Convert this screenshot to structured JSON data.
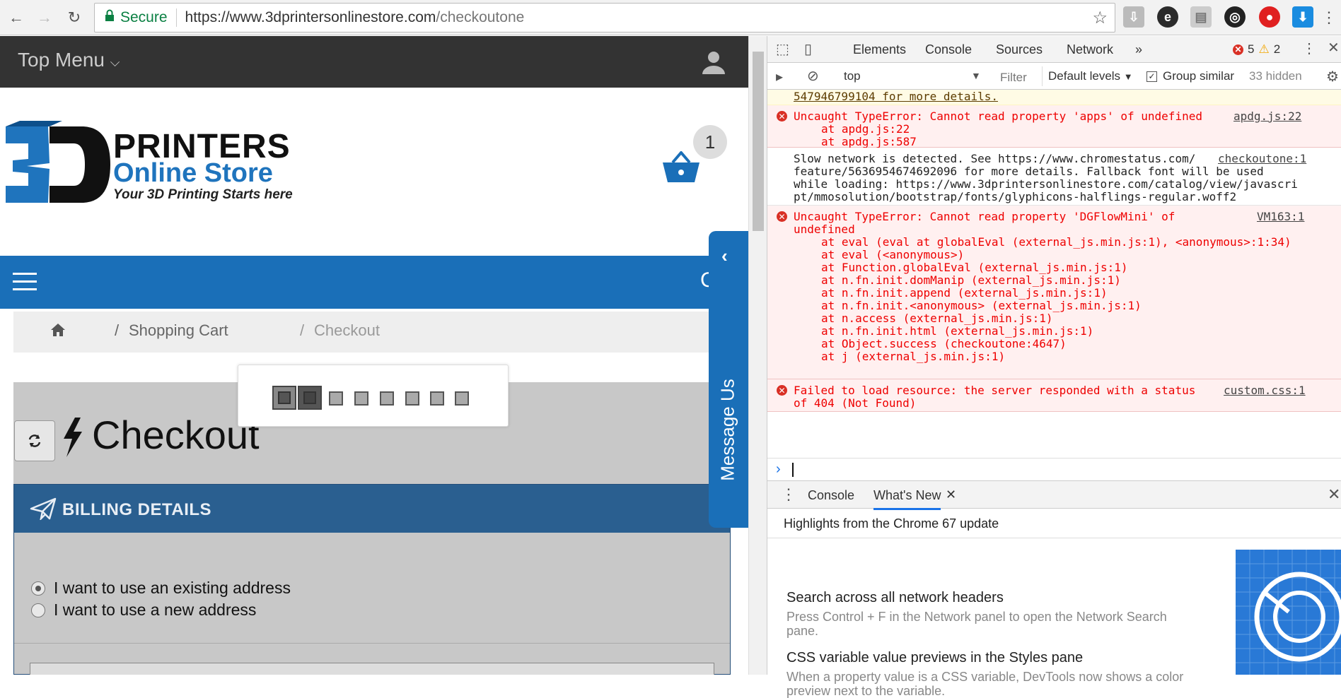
{
  "browser": {
    "secure_label": "Secure",
    "url_host": "https://www.3dprintersonlinestore.com",
    "url_path": "/checkoutone"
  },
  "page": {
    "top_menu_label": "Top Menu",
    "logo": {
      "mark": "3D",
      "line1": "PRINTERS",
      "line2": "Online Store",
      "tagline": "Your 3D Printing Starts here"
    },
    "cart_count": "1",
    "search_partial": "C",
    "breadcrumb": {
      "sep": "/",
      "cart": "Shopping Cart",
      "checkout": "Checkout"
    },
    "checkout_title": "Checkout",
    "billing": {
      "title": "BILLING DETAILS",
      "option_existing": "I want to use an existing address",
      "option_new": "I want to use a new address",
      "selected": "existing"
    },
    "message_us": "Message Us"
  },
  "devtools": {
    "tabs": [
      "Elements",
      "Console",
      "Sources",
      "Network"
    ],
    "active_tab": "Console",
    "more": "»",
    "error_count": "5",
    "warning_count": "2",
    "toolbar": {
      "context": "top",
      "filter_placeholder": "Filter",
      "levels": "Default levels",
      "group_similar": "Group similar",
      "hidden": "33 hidden"
    },
    "console": {
      "warn_partial": "547946799104 for more details.",
      "msg1": {
        "text": "Uncaught TypeError: Cannot read property 'apps' of undefined",
        "src": "apdg.js:22",
        "stack": [
          "at apdg.js:22",
          "at apdg.js:587"
        ]
      },
      "msg2": {
        "line1": "Slow network is detected. See https://www.chromestatus.com/",
        "line2": "feature/5636954674692096 for more details. Fallback font will be used",
        "line3": "while loading: https://www.3dprintersonlinestore.com/catalog/view/javascri",
        "line4": "pt/mmosolution/bootstrap/fonts/glyphicons-halflings-regular.woff2",
        "src": "checkoutone:1"
      },
      "msg3": {
        "line1": "Uncaught TypeError: Cannot read property 'DGFlowMini' of",
        "line2": "undefined",
        "src": "VM163:1",
        "stack": [
          "at eval (eval at globalEval (external_js.min.js:1), <anonymous>:1:34)",
          "at eval (<anonymous>)",
          "at Function.globalEval (external_js.min.js:1)",
          "at n.fn.init.domManip (external_js.min.js:1)",
          "at n.fn.init.append (external_js.min.js:1)",
          "at n.fn.init.<anonymous> (external_js.min.js:1)",
          "at n.access (external_js.min.js:1)",
          "at n.fn.init.html (external_js.min.js:1)",
          "at Object.success (checkoutone:4647)",
          "at j (external_js.min.js:1)"
        ]
      },
      "msg4": {
        "line1": "Failed to load resource: the server responded with a status",
        "line2": "of 404 (Not Found)",
        "src": "custom.css:1"
      }
    },
    "drawer": {
      "tab_console": "Console",
      "tab_whatsnew": "What's New",
      "header": "Highlights from the Chrome 67 update",
      "items": [
        {
          "title": "Search across all network headers",
          "desc": "Press Control + F in the Network panel to open the Network Search pane."
        },
        {
          "title": "CSS variable value previews in the Styles pane",
          "desc": "When a property value is a CSS variable, DevTools now shows a color preview next to the variable."
        }
      ]
    }
  },
  "colors": {
    "brand_blue": "#1a6fb8",
    "billing_header": "#2a5f90",
    "error_red": "#d93025"
  }
}
